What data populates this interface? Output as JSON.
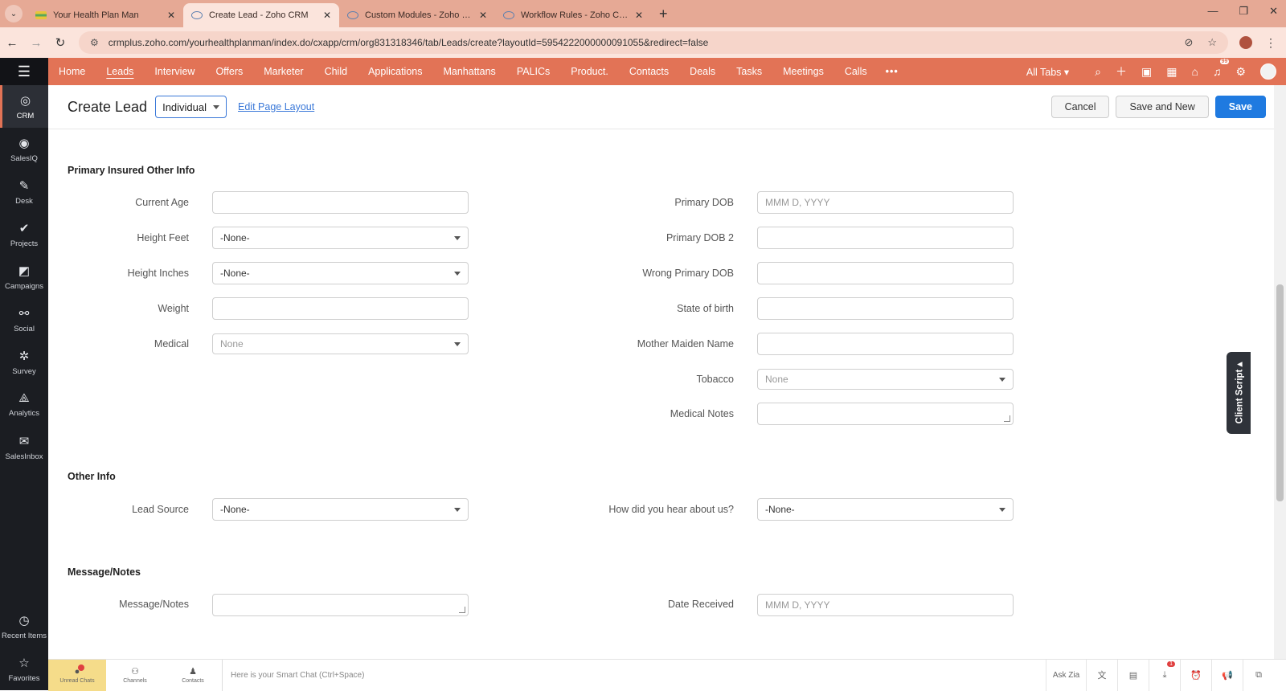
{
  "browser": {
    "tabs": [
      {
        "title": "Your Health Plan Man",
        "favicon": "health-favicon",
        "active": false
      },
      {
        "title": "Create Lead - Zoho CRM",
        "favicon": "zoho-eye-favicon",
        "active": true
      },
      {
        "title": "Custom Modules - Zoho CRM",
        "favicon": "zoho-eye-favicon",
        "active": false
      },
      {
        "title": "Workflow Rules - Zoho CRM",
        "favicon": "zoho-eye-favicon",
        "active": false
      }
    ],
    "url": "crmplus.zoho.com/yourhealthplanman/index.do/cxapp/crm/org831318346/tab/Leads/create?layoutId=5954222000000091055&redirect=false"
  },
  "rail": {
    "items": [
      {
        "label": "CRM",
        "icon": "eye-icon"
      },
      {
        "label": "SalesIQ",
        "icon": "chat-icon"
      },
      {
        "label": "Desk",
        "icon": "desk-icon"
      },
      {
        "label": "Projects",
        "icon": "check-icon"
      },
      {
        "label": "Campaigns",
        "icon": "megaphone-icon"
      },
      {
        "label": "Social",
        "icon": "social-icon"
      },
      {
        "label": "Survey",
        "icon": "survey-icon"
      },
      {
        "label": "Analytics",
        "icon": "analytics-icon"
      },
      {
        "label": "SalesInbox",
        "icon": "inbox-icon"
      }
    ],
    "bottom": [
      {
        "label": "Recent Items",
        "icon": "clock-icon"
      },
      {
        "label": "Favorites",
        "icon": "star-icon"
      }
    ]
  },
  "modules": {
    "items": [
      "Home",
      "Leads",
      "Interview",
      "Offers",
      "Marketer",
      "Child",
      "Applications",
      "Manhattans",
      "PALICs",
      "Product.",
      "Contacts",
      "Deals",
      "Tasks",
      "Meetings",
      "Calls"
    ],
    "active": "Leads",
    "all_tabs": "All Tabs",
    "notif_count": "99"
  },
  "header": {
    "title": "Create Lead",
    "layout": "Individual",
    "edit_layout": "Edit Page Layout",
    "cancel": "Cancel",
    "save_new": "Save and New",
    "save": "Save"
  },
  "sections": {
    "primary": {
      "title": "Primary Insured Other Info",
      "left": [
        {
          "label": "Current Age",
          "value": "",
          "type": "text"
        },
        {
          "label": "Height Feet",
          "value": "-None-",
          "type": "select"
        },
        {
          "label": "Height Inches",
          "value": "-None-",
          "type": "select"
        },
        {
          "label": "Weight",
          "value": "",
          "type": "text"
        },
        {
          "label": "Medical",
          "value": "None",
          "type": "multiselect"
        }
      ],
      "right": [
        {
          "label": "Primary DOB",
          "placeholder": "MMM D, YYYY",
          "type": "date"
        },
        {
          "label": "Primary DOB 2",
          "value": "",
          "type": "text"
        },
        {
          "label": "Wrong Primary DOB",
          "value": "",
          "type": "text"
        },
        {
          "label": "State of birth",
          "value": "",
          "type": "text"
        },
        {
          "label": "Mother Maiden Name",
          "value": "",
          "type": "text"
        },
        {
          "label": "Tobacco",
          "value": "None",
          "type": "multiselect"
        },
        {
          "label": "Medical Notes",
          "value": "",
          "type": "textarea"
        }
      ]
    },
    "other": {
      "title": "Other Info",
      "lead_source_label": "Lead Source",
      "lead_source_value": "-None-",
      "hear_label": "How did you hear about us?",
      "hear_value": "-None-"
    },
    "notes": {
      "title": "Message/Notes",
      "message_label": "Message/Notes",
      "date_label": "Date Received",
      "date_placeholder": "MMM D, YYYY"
    }
  },
  "client_script": "Client Script",
  "bottombar": {
    "unread": "Unread Chats",
    "channels": "Channels",
    "contacts": "Contacts",
    "smartchat": "Here is your Smart Chat (Ctrl+Space)",
    "ask_zia": "Ask Zia",
    "download_badge": "1"
  }
}
